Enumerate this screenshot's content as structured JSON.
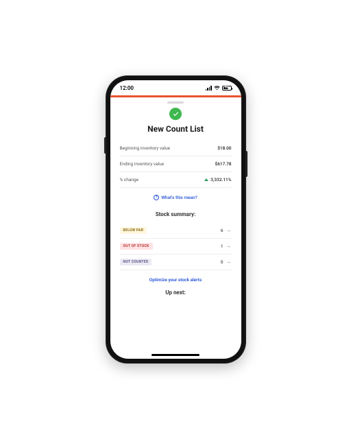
{
  "status": {
    "time": "12:00",
    "battery_pct": "76"
  },
  "page": {
    "title": "New Count List",
    "rows": {
      "begin_label": "Beginning inventory value",
      "begin_value": "$18.00",
      "end_label": "Ending inventory value",
      "end_value": "$617.78",
      "pct_label": "% change",
      "pct_value": "3,332.11%"
    },
    "help_link": "What's this mean?",
    "stock_heading": "Stock summary:",
    "stock": {
      "below_label": "BELOW PAR",
      "below_count": "6",
      "out_label": "OUT OF STOCK",
      "out_count": "1",
      "not_label": "NOT COUNTED",
      "not_count": "0"
    },
    "optimize_link": "Optimize your stock alerts",
    "up_next": "Up next:"
  }
}
